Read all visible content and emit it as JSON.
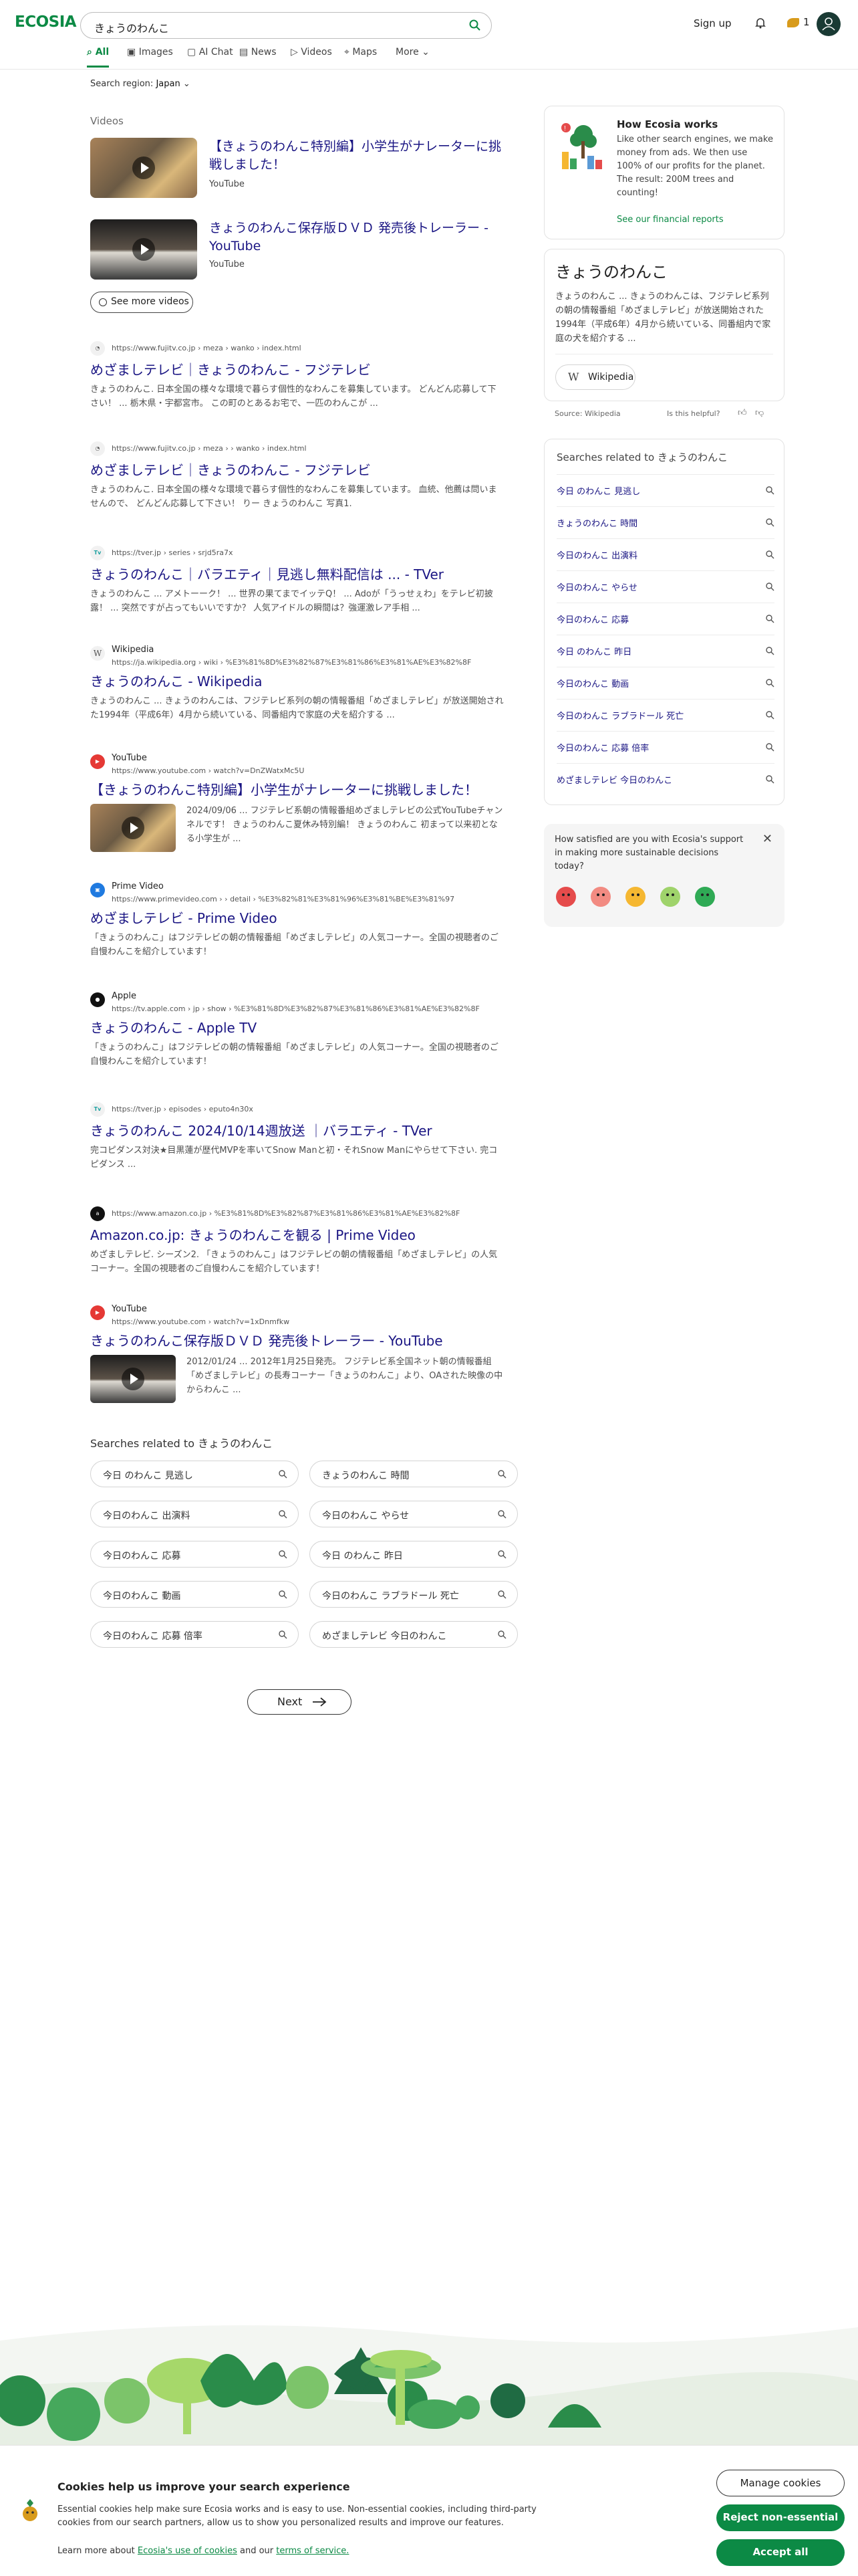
{
  "header": {
    "logo": "ECOSIA",
    "search_value": "きょうのわんこ",
    "signup": "Sign up",
    "seed_count": "1"
  },
  "tabs": [
    {
      "label": "All",
      "icon": "search-icon"
    },
    {
      "label": "Images",
      "icon": "image-icon"
    },
    {
      "label": "AI Chat",
      "icon": "chat-icon"
    },
    {
      "label": "News",
      "icon": "news-icon"
    },
    {
      "label": "Videos",
      "icon": "play-icon"
    },
    {
      "label": "Maps",
      "icon": "pin-icon"
    },
    {
      "label": "More",
      "icon": "chevron-down-icon"
    }
  ],
  "region": {
    "label": "Search region:",
    "value": "Japan"
  },
  "videos": {
    "label": "Videos",
    "items": [
      {
        "title": "【きょうのわんこ特別編】小学生がナレーターに挑戦しました！",
        "source": "YouTube"
      },
      {
        "title": "きょうのわんこ保存版ＤＶＤ 発売後トレーラー - YouTube",
        "source": "YouTube"
      }
    ],
    "see_more": "See more videos"
  },
  "results": [
    {
      "site": "",
      "url": "https://www.fujitv.co.jp › meza › wanko › index.html",
      "title": "めざましテレビ｜きょうのわんこ - フジテレビ",
      "snippet": "きょうのわんこ. 日本全国の様々な環境で暮らす個性的なわんこを募集しています。 どんどん応募して下さい！ ... 栃木県・宇都宮市。 この町のとあるお宅で、一匹のわんこが ..."
    },
    {
      "site": "",
      "url": "https://www.fujitv.co.jp › meza › › wanko › index.html",
      "title": "めざましテレビ｜きょうのわんこ - フジテレビ",
      "snippet": "きょうのわんこ. 日本全国の様々な環境で暮らす個性的なわんこを募集しています。 血統、他薦は問いませんので、 どんどん応募して下さい！ りー きょうのわんこ 写真1."
    },
    {
      "site": "",
      "url": "https://tver.jp › series › srjd5ra7x",
      "title": "きょうのわんこ｜バラエティ｜見逃し無料配信は ... - TVer",
      "snippet": "きょうのわんこ ... アメトーーク！ ... 世界の果てまでイッテQ！ ... Adoが「うっせぇわ」をテレビ初披露！ ... 突然ですが占ってもいいですか？ 人気アイドルの瞬間は？強運激レア手相 ..."
    },
    {
      "site": "Wikipedia",
      "url": "https://ja.wikipedia.org › wiki › %E3%81%8D%E3%82%87%E3%81%86%E3%81%AE%E3%82%8F",
      "title": "きょうのわんこ - Wikipedia",
      "snippet": "きょうのわんこ ... きょうのわんこは、フジテレビ系列の朝の情報番組「めざましテレビ」が放送開始された1994年（平成6年）4月から続いている、同番組内で家庭の犬を紹介する ..."
    },
    {
      "site": "YouTube",
      "url": "https://www.youtube.com › watch?v=DnZWatxMc5U",
      "title": "【きょうのわんこ特別編】小学生がナレーターに挑戦しました！",
      "snippet": "2024/09/06 ... フジテレビ系朝の情報番組めざましテレビの公式YouTubeチャンネルです！ きょうのわんこ夏休み特別編！ きょうのわんこ 初まって以来初となる小学生が ..."
    },
    {
      "site": "Prime Video",
      "url": "https://www.primevideo.com › › detail › %E3%82%81%E3%81%96%E3%81%BE%E3%81%97",
      "title": "めざましテレビ - Prime Video",
      "snippet": "「きょうのわんこ」はフジテレビの朝の情報番組「めざましテレビ」の人気コーナー。全国の視聴者のご自慢わんこを紹介しています！"
    },
    {
      "site": "Apple",
      "url": "https://tv.apple.com › jp › show › %E3%81%8D%E3%82%87%E3%81%86%E3%81%AE%E3%82%8F",
      "title": "きょうのわんこ - Apple TV",
      "snippet": "「きょうのわんこ」はフジテレビの朝の情報番組「めざましテレビ」の人気コーナー。全国の視聴者のご自慢わんこを紹介しています！"
    },
    {
      "site": "",
      "url": "https://tver.jp › episodes › eputo4n30x",
      "title": "きょうのわんこ 2024/10/14週放送 ｜バラエティ - TVer",
      "snippet": "完コピダンス対決★目黒蓮が歴代MVPを率いてSnow Manと初・それSnow Manにやらせて下さい. 完コピダンス ..."
    },
    {
      "site": "",
      "url": "https://www.amazon.co.jp › %E3%81%8D%E3%82%87%E3%81%86%E3%81%AE%E3%82%8F",
      "title": "Amazon.co.jp: きょうのわんこを観る | Prime Video",
      "snippet": "めざましテレビ. シーズン2. 「きょうのわんこ」はフジテレビの朝の情報番組「めざましテレビ」の人気コーナー。全国の視聴者のご自慢わんこを紹介しています！"
    },
    {
      "site": "YouTube",
      "url": "https://www.youtube.com › watch?v=1xDnmfkw",
      "title": "きょうのわんこ保存版ＤＶＤ 発売後トレーラー - YouTube",
      "snippet": "2012/01/24 ... 2012年1月25日発売。 フジテレビ系全国ネット朝の情報番組「めざましテレビ」の長寿コーナー「きょうのわんこ」より、OAされた映像の中からわんこ ..."
    }
  ],
  "related": {
    "title": "Searches related to きょうのわんこ",
    "items": [
      "今日 のわんこ 見逃し",
      "きょうのわんこ 時間",
      "今日のわんこ 出演料",
      "今日のわんこ やらせ",
      "今日のわんこ 応募",
      "今日 のわんこ 昨日",
      "今日のわんこ 動画",
      "今日のわんこ ラブラドール 死亡",
      "今日のわんこ 応募 倍率",
      "めざましテレビ 今日のわんこ"
    ]
  },
  "next_label": "Next",
  "sidebar": {
    "how": {
      "title": "How Ecosia works",
      "desc": "Like other search engines, we make money from ads. We then use 100% of our profits for the planet. The result: 200M trees and counting!",
      "link": "See our financial reports"
    },
    "knowledge": {
      "title": "きょうのわんこ",
      "desc": "きょうのわんこ ... きょうのわんこは、フジテレビ系列の朝の情報番組「めざましテレビ」が放送開始された1994年（平成6年）4月から続いている、同番組内で家庭の犬を紹介する ...",
      "wiki_label": "Wikipedia",
      "source": "Source: Wikipedia",
      "helpful": "Is this helpful?"
    },
    "related_title": "Searches related to きょうのわんこ",
    "satisfaction": {
      "question": "How satisfied are you with Ecosia's support in making more sustainable decisions today?"
    }
  },
  "cookie": {
    "title": "Cookies help us improve your search experience",
    "desc": "Essential cookies help make sure Ecosia works and is easy to use. Non-essential cookies, including third-party cookies from our search partners, allow us to show you personalized results and improve our features.",
    "learn_prefix": "Learn more about",
    "learn_link": "Ecosia's use of cookies",
    "learn_mid": "and our",
    "learn_link2": "terms of service.",
    "manage": "Manage cookies",
    "reject": "Reject non-essential",
    "accept": "Accept all"
  },
  "colors": {
    "brand": "#0c8a45",
    "link": "#1a1583"
  }
}
